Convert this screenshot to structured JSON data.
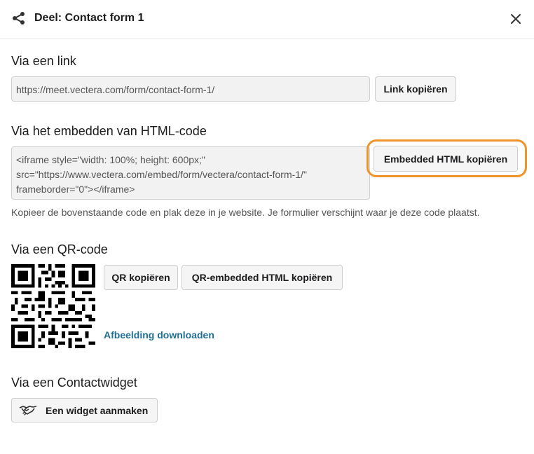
{
  "header": {
    "title": "Deel: Contact form 1"
  },
  "link_section": {
    "title": "Via een link",
    "url": "https://meet.vectera.com/form/contact-form-1/",
    "copy_label": "Link kopiëren"
  },
  "embed_section": {
    "title": "Via het embedden van HTML-code",
    "code_lines": [
      "<iframe style=\"width: 100%; height: 600px;\"",
      "src=\"https://www.vectera.com/embed/form/vectera/contact-form-1/\"",
      "frameborder=\"0\"></iframe>"
    ],
    "copy_label": "Embedded HTML kopiëren",
    "hint": "Kopieer de bovenstaande code en plak deze in je website. Je formulier verschijnt waar je deze code plaatst."
  },
  "qr_section": {
    "title": "Via een QR-code",
    "copy_qr_label": "QR kopiëren",
    "copy_qr_embed_label": "QR-embedded HTML kopiëren",
    "download_label": "Afbeelding downloaden"
  },
  "widget_section": {
    "title": "Via een Contactwidget",
    "create_label": "Een widget aanmaken"
  },
  "colors": {
    "highlight": "#f0942a",
    "link": "#1f6f93",
    "field_bg": "#f2f2f2",
    "button_bg": "#f5f5f5"
  },
  "icons": [
    "share-icon",
    "close-icon",
    "qr-code-image",
    "handshake-icon"
  ]
}
